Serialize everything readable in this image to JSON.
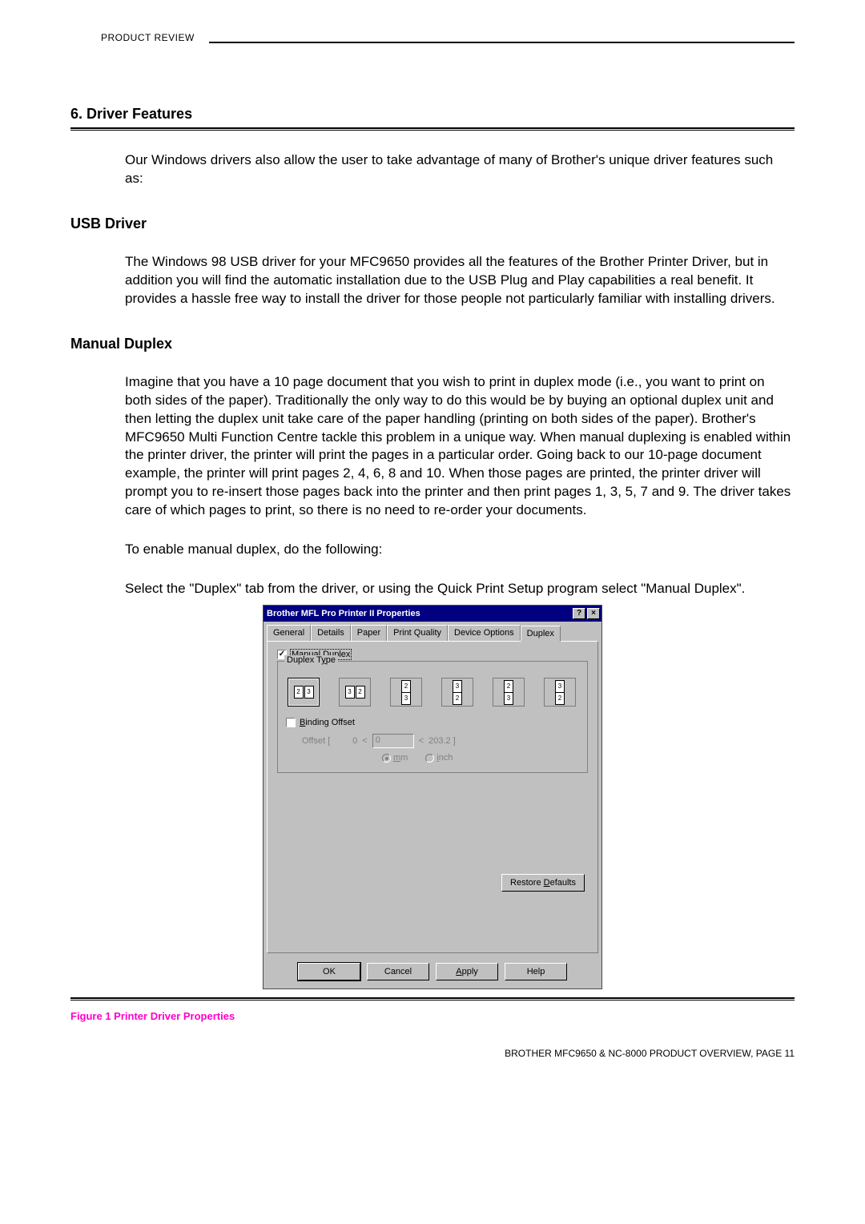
{
  "header": {
    "label": "PRODUCT REVIEW"
  },
  "section": {
    "title": "6. Driver Features"
  },
  "intro": "Our Windows drivers also allow the user to take advantage of many of Brother's unique driver features such as:",
  "usb": {
    "title": "USB Driver",
    "body": "The Windows 98 USB driver for your MFC9650 provides all the features of the Brother Printer Driver, but in addition you will find the  automatic installation due to the USB Plug and Play capabilities a real benefit. It provides a hassle free way to install the driver for those people not particularly familiar with installing drivers."
  },
  "manual_duplex": {
    "title": "Manual Duplex",
    "body": "Imagine that you have a 10 page document that you wish to print in duplex mode (i.e., you want to print on both sides of the paper). Traditionally the only way to do this would be by buying an optional duplex unit and then letting the duplex unit take care of the paper handling (printing on both sides of the paper). Brother's MFC9650 Multi Function Centre tackle this problem in a unique way. When manual duplexing is enabled within the printer driver, the printer will print the pages in a particular order. Going back to our 10-page document example, the printer will print pages 2, 4, 6, 8 and 10. When those pages are printed, the printer driver will prompt you to re-insert those pages back into the printer and then print pages 1, 3, 5, 7 and 9. The driver takes care of which pages to print, so there is no need to re-order your documents.",
    "enable": "To enable manual duplex, do the following:",
    "select": "Select the \"Duplex\" tab from the driver, or using the Quick Print Setup program select \"Manual Duplex\"."
  },
  "dialog": {
    "title": "Brother MFL Pro Printer II Properties",
    "tabs": [
      "General",
      "Details",
      "Paper",
      "Print Quality",
      "Device Options",
      "Duplex"
    ],
    "active_tab_index": 5,
    "manual_duplex_label": "Manual Duplex",
    "manual_duplex_checked": true,
    "duplex_type_label": "Duplex Type",
    "binding_offset_label": "Binding Offset",
    "binding_offset_checked": false,
    "offset_label": "Offset [",
    "offset_min": "0",
    "offset_lt1": "<",
    "offset_value": "0",
    "offset_lt2": "<",
    "offset_max": "203.2  ]",
    "unit_mm": "mm",
    "unit_inch": "inch",
    "unit_selected": "mm",
    "restore": "Restore Defaults",
    "buttons": {
      "ok": "OK",
      "cancel": "Cancel",
      "apply": "Apply",
      "help": "Help"
    }
  },
  "figure_caption": "Figure 1 Printer Driver Properties",
  "footer": "BROTHER MFC9650 & NC-8000 PRODUCT OVERVIEW, PAGE 11"
}
